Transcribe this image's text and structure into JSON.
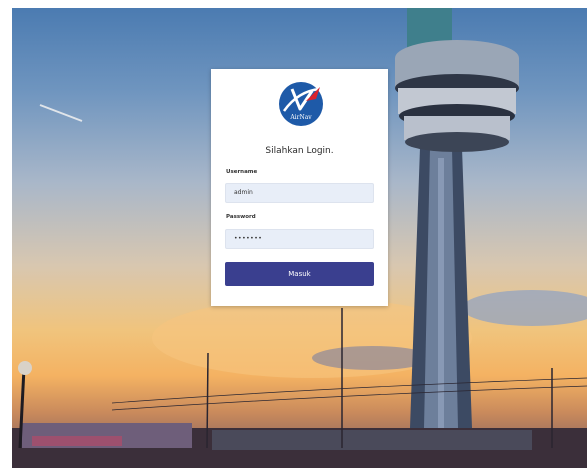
{
  "login": {
    "logo_text": "AirNav",
    "title": "Silahkan Login.",
    "username_label": "Username",
    "username_value": "admin",
    "password_label": "Password",
    "password_value": "•••••••",
    "submit_label": "Masuk"
  },
  "colors": {
    "button": "#3a3f8f",
    "input_bg": "#e8eef8",
    "logo_blue": "#1e5aa8",
    "logo_red": "#d9232d"
  }
}
